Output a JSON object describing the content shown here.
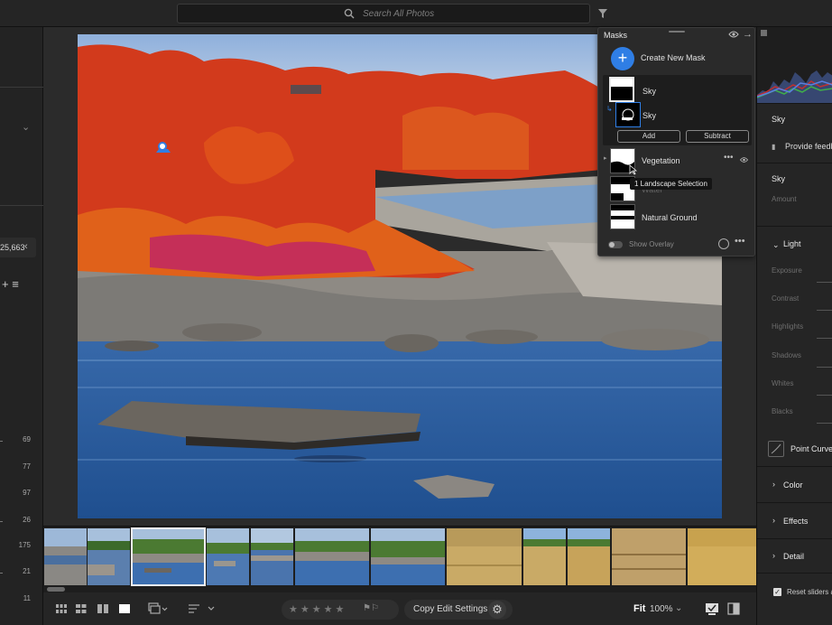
{
  "search": {
    "placeholder": "Search All Photos"
  },
  "left_rail": {
    "photo_count": "25,663",
    "numbers": [
      "69",
      "77",
      "97",
      "26",
      "175",
      "21",
      "11"
    ]
  },
  "masks_panel": {
    "title": "Masks",
    "create_label": "Create New Mask",
    "group_name": "Sky",
    "group_sub_name": "Sky",
    "add_label": "Add",
    "subtract_label": "Subtract",
    "items": [
      {
        "label": "Vegetation"
      },
      {
        "label": "Water"
      },
      {
        "label": "Natural Ground"
      }
    ],
    "tooltip": "1 Landscape Selection",
    "show_overlay_label": "Show Overlay",
    "show_overlay_on": false
  },
  "right_panel": {
    "mask_name": "Sky",
    "feedback_label": "Provide feedback",
    "section_name": "Sky",
    "amount_label": "Amount",
    "light_label": "Light",
    "sliders": [
      "Exposure",
      "Contrast",
      "Highlights",
      "Shadows",
      "Whites",
      "Blacks"
    ],
    "point_curve_label": "Point Curve",
    "color_label": "Color",
    "effects_label": "Effects",
    "detail_label": "Detail",
    "reset_label": "Reset sliders automatically",
    "reset_checked": true
  },
  "toolbar": {
    "copy_label": "Copy Edit Settings",
    "fit_label": "Fit",
    "zoom_label": "100%",
    "rating": 0
  },
  "colors": {
    "accent": "#2f7ee5",
    "mask_overlay": "#d23a1c"
  }
}
